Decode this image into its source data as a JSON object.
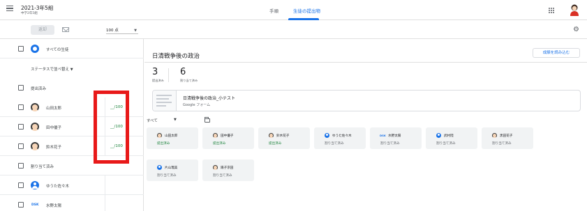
{
  "app": {
    "class_title": "2021-3年5組",
    "class_subtitle": "中学2年5組"
  },
  "tabs": [
    {
      "label": "手順",
      "active": false
    },
    {
      "label": "生徒の提出物",
      "active": true
    }
  ],
  "toolbar": {
    "return_label": "返却",
    "points_value": "100 点"
  },
  "left_panel": {
    "all_students_label": "すべての生徒",
    "sort_label": "ステータスで並べ替え",
    "groups": [
      {
        "label": "提出済み",
        "students": [
          {
            "name": "山田太郎",
            "grade": "__/100"
          },
          {
            "name": "田中優子",
            "grade": "__/100"
          },
          {
            "name": "鈴木花子",
            "grade": "__/100"
          }
        ]
      },
      {
        "label": "割り当て済み",
        "students": [
          {
            "name": "ゆうた佐々木",
            "grade": ""
          },
          {
            "name": "水野太陽",
            "grade": "",
            "avatar_text": "DSK"
          }
        ]
      }
    ]
  },
  "main": {
    "title": "日清戦争後の政治",
    "import_button": "成績を読み込む",
    "stats": [
      {
        "number": "3",
        "label": "提出済み"
      },
      {
        "number": "6",
        "label": "割り当て済み"
      }
    ],
    "attachment": {
      "title": "日清戦争後の政治_小テスト",
      "type": "Google フォーム"
    },
    "filter_label": "すべて",
    "cards": [
      {
        "name": "山田太郎",
        "status": "提出済み",
        "avatar": "face"
      },
      {
        "name": "田中優子",
        "status": "提出済み",
        "avatar": "face"
      },
      {
        "name": "鈴木花子",
        "status": "提出済み",
        "avatar": "face"
      },
      {
        "name": "ゆうた佐々木",
        "status": "割り当て済み",
        "avatar": "blue"
      },
      {
        "name": "水野太陽",
        "status": "割り当て済み",
        "avatar": "DSK"
      },
      {
        "name": "武村陸",
        "status": "割り当て済み",
        "avatar": "blue"
      },
      {
        "name": "黒田花子",
        "status": "割り当て済み",
        "avatar": "face"
      },
      {
        "name": "片山瑠美",
        "status": "割り当て済み",
        "avatar": "blue"
      },
      {
        "name": "陽子京田",
        "status": "割り当て済み",
        "avatar": "face"
      }
    ]
  },
  "colors": {
    "accent": "#1a73e8",
    "submitted_green": "#188038",
    "highlight_red": "#e81919"
  },
  "icons": [
    "menu-icon",
    "mail-icon",
    "apps-icon",
    "settings-icon",
    "folder-icon",
    "group-icon"
  ]
}
